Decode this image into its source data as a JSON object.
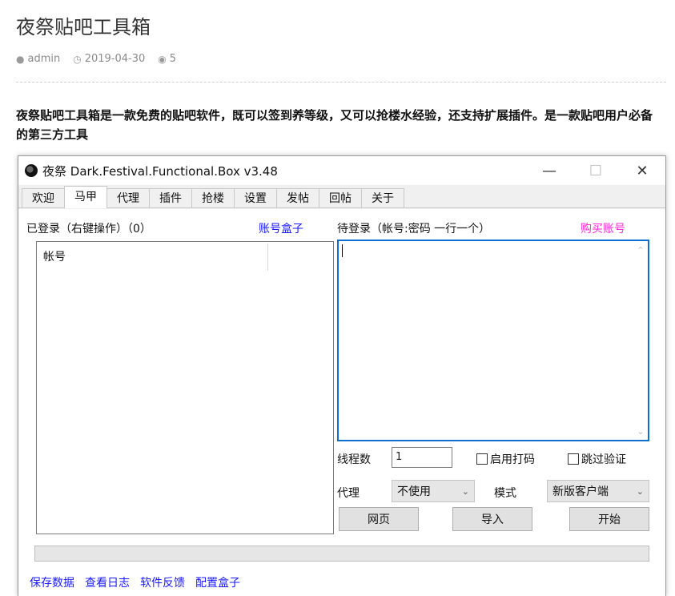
{
  "article": {
    "title": "夜祭贴吧工具箱",
    "author": "admin",
    "date": "2019-04-30",
    "comments": "5",
    "lead": "夜祭贴吧工具箱是一款免费的贴吧软件，既可以签到养等级，又可以抢楼水经验，还支持扩展插件。是一款贴吧用户必备的第三方工具"
  },
  "window": {
    "title": "夜祭 Dark.Festival.Functional.Box v3.48",
    "minimize": "—",
    "maximize": "☐",
    "close": "✕"
  },
  "tabs": [
    {
      "label": "欢迎"
    },
    {
      "label": "马甲"
    },
    {
      "label": "代理"
    },
    {
      "label": "插件"
    },
    {
      "label": "抢楼"
    },
    {
      "label": "设置"
    },
    {
      "label": "发帖"
    },
    {
      "label": "回帖"
    },
    {
      "label": "关于"
    }
  ],
  "panel": {
    "logged_label": "已登录（右键操作）（0）",
    "account_box_link": "账号盒子",
    "list_header": "帐号",
    "pending_label": "待登录（帐号:密码 一行一个）",
    "buy_link": "购买账号",
    "threads_label": "线程数",
    "threads_value": "1",
    "check_captcha": "启用打码",
    "check_skip": "跳过验证",
    "proxy_label": "代理",
    "proxy_value": "不使用",
    "mode_label": "模式",
    "mode_value": "新版客户端",
    "btn_web": "网页",
    "btn_import": "导入",
    "btn_start": "开始"
  },
  "bottom_links": [
    "保存数据",
    "查看日志",
    "软件反馈",
    "配置盒子"
  ],
  "icons": {
    "author": "user-icon",
    "date": "clock-icon",
    "comments": "comment-icon"
  }
}
